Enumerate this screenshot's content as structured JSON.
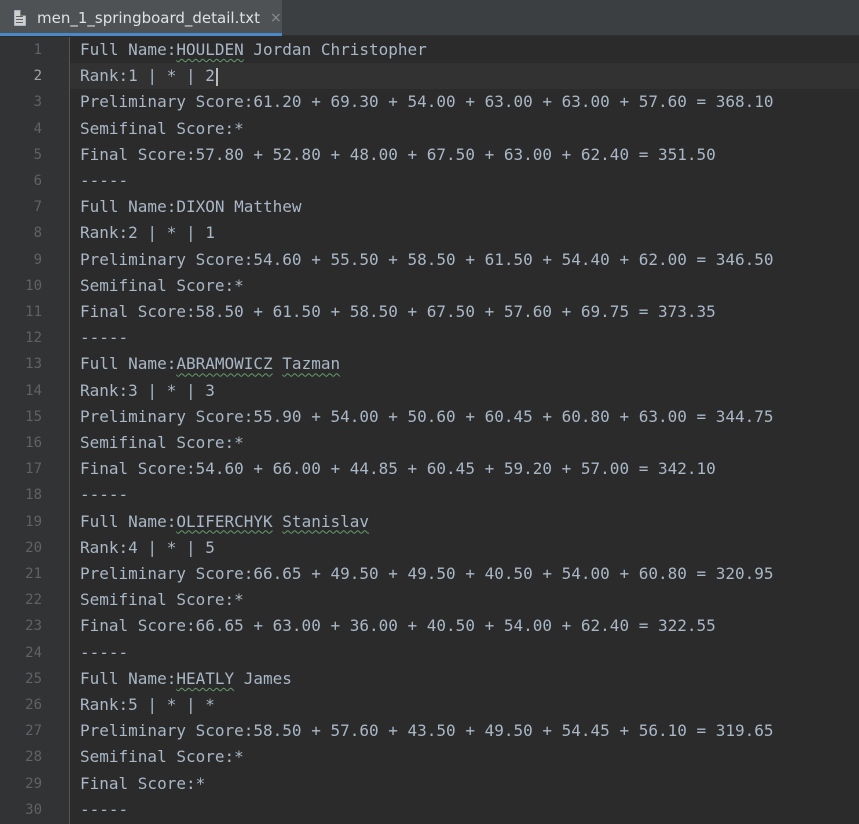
{
  "tab": {
    "title": "men_1_springboard_detail.txt",
    "close_glyph": "×",
    "icon": "text-file-icon"
  },
  "editor": {
    "current_line": 2,
    "lines": [
      {
        "no": "1",
        "segments": [
          {
            "text": "Full Name:"
          },
          {
            "text": "HOULDEN",
            "typo": true
          },
          {
            "text": " Jordan Christopher"
          }
        ]
      },
      {
        "no": "2",
        "segments": [
          {
            "text": "Rank:1 | * | 2"
          }
        ],
        "caret": true
      },
      {
        "no": "3",
        "segments": [
          {
            "text": "Preliminary Score:61.20 + 69.30 + 54.00 + 63.00 + 63.00 + 57.60 = 368.10"
          }
        ]
      },
      {
        "no": "4",
        "segments": [
          {
            "text": "Semifinal Score:*"
          }
        ]
      },
      {
        "no": "5",
        "segments": [
          {
            "text": "Final Score:57.80 + 52.80 + 48.00 + 67.50 + 63.00 + 62.40 = 351.50"
          }
        ]
      },
      {
        "no": "6",
        "segments": [
          {
            "text": "-----"
          }
        ]
      },
      {
        "no": "7",
        "segments": [
          {
            "text": "Full Name:DIXON Matthew"
          }
        ]
      },
      {
        "no": "8",
        "segments": [
          {
            "text": "Rank:2 | * | 1"
          }
        ]
      },
      {
        "no": "9",
        "segments": [
          {
            "text": "Preliminary Score:54.60 + 55.50 + 58.50 + 61.50 + 54.40 + 62.00 = 346.50"
          }
        ]
      },
      {
        "no": "10",
        "segments": [
          {
            "text": "Semifinal Score:*"
          }
        ]
      },
      {
        "no": "11",
        "segments": [
          {
            "text": "Final Score:58.50 + 61.50 + 58.50 + 67.50 + 57.60 + 69.75 = 373.35"
          }
        ]
      },
      {
        "no": "12",
        "segments": [
          {
            "text": "-----"
          }
        ]
      },
      {
        "no": "13",
        "segments": [
          {
            "text": "Full Name:"
          },
          {
            "text": "ABRAMOWICZ",
            "typo": true
          },
          {
            "text": " "
          },
          {
            "text": "Tazman",
            "typo": true
          }
        ]
      },
      {
        "no": "14",
        "segments": [
          {
            "text": "Rank:3 | * | 3"
          }
        ]
      },
      {
        "no": "15",
        "segments": [
          {
            "text": "Preliminary Score:55.90 + 54.00 + 50.60 + 60.45 + 60.80 + 63.00 = 344.75"
          }
        ]
      },
      {
        "no": "16",
        "segments": [
          {
            "text": "Semifinal Score:*"
          }
        ]
      },
      {
        "no": "17",
        "segments": [
          {
            "text": "Final Score:54.60 + 66.00 + 44.85 + 60.45 + 59.20 + 57.00 = 342.10"
          }
        ]
      },
      {
        "no": "18",
        "segments": [
          {
            "text": "-----"
          }
        ]
      },
      {
        "no": "19",
        "segments": [
          {
            "text": "Full Name:"
          },
          {
            "text": "OLIFERCHYK",
            "typo": true
          },
          {
            "text": " "
          },
          {
            "text": "Stanislav",
            "typo": true
          }
        ]
      },
      {
        "no": "20",
        "segments": [
          {
            "text": "Rank:4 | * | 5"
          }
        ]
      },
      {
        "no": "21",
        "segments": [
          {
            "text": "Preliminary Score:66.65 + 49.50 + 49.50 + 40.50 + 54.00 + 60.80 = 320.95"
          }
        ]
      },
      {
        "no": "22",
        "segments": [
          {
            "text": "Semifinal Score:*"
          }
        ]
      },
      {
        "no": "23",
        "segments": [
          {
            "text": "Final Score:66.65 + 63.00 + 36.00 + 40.50 + 54.00 + 62.40 = 322.55"
          }
        ]
      },
      {
        "no": "24",
        "segments": [
          {
            "text": "-----"
          }
        ]
      },
      {
        "no": "25",
        "segments": [
          {
            "text": "Full Name:"
          },
          {
            "text": "HEATLY",
            "typo": true
          },
          {
            "text": " James"
          }
        ]
      },
      {
        "no": "26",
        "segments": [
          {
            "text": "Rank:5 | * | *"
          }
        ]
      },
      {
        "no": "27",
        "segments": [
          {
            "text": "Preliminary Score:58.50 + 57.60 + 43.50 + 49.50 + 54.45 + 56.10 = 319.65"
          }
        ]
      },
      {
        "no": "28",
        "segments": [
          {
            "text": "Semifinal Score:*"
          }
        ]
      },
      {
        "no": "29",
        "segments": [
          {
            "text": "Final Score:*"
          }
        ]
      },
      {
        "no": "30",
        "segments": [
          {
            "text": "-----"
          }
        ]
      }
    ]
  },
  "colors": {
    "background": "#2b2b2b",
    "gutter": "#313335",
    "text": "#a9b7c6",
    "line_number": "#606366",
    "tab_accent": "#4a88c7"
  }
}
